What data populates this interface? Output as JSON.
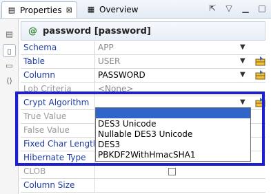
{
  "tabs": [
    {
      "label": "Properties",
      "close": "⊠"
    },
    {
      "label": "Overview"
    }
  ],
  "header": {
    "at": "@",
    "title": "password [password]"
  },
  "rows": [
    {
      "label": "Schema",
      "value": "APP",
      "dim_value": true
    },
    {
      "label": "Table",
      "value": "USER",
      "dim_value": true
    },
    {
      "label": "Column",
      "value": "PASSWORD",
      "dim_value": false
    },
    {
      "label": "Lob Criteria",
      "value": "<None>",
      "dim_value": true
    },
    {
      "label": "Crypt Algorithm",
      "value": ""
    },
    {
      "label": "True Value",
      "value": ""
    },
    {
      "label": "False Value",
      "value": ""
    },
    {
      "label": "Fixed Char Length",
      "value": ""
    },
    {
      "label": "Hibernate Type",
      "value": ""
    },
    {
      "label": "CLOB",
      "value": ""
    },
    {
      "label": "Column Size",
      "value": ""
    }
  ],
  "dropdown": {
    "options": [
      "DES3 Unicode",
      "Nullable DES3 Unicode",
      "DES3",
      "PBKDF2WithHmacSHA1"
    ]
  },
  "colors": {
    "highlight": "#1d1fd0",
    "label": "#1f3ea5",
    "selection": "#2f65c9"
  }
}
